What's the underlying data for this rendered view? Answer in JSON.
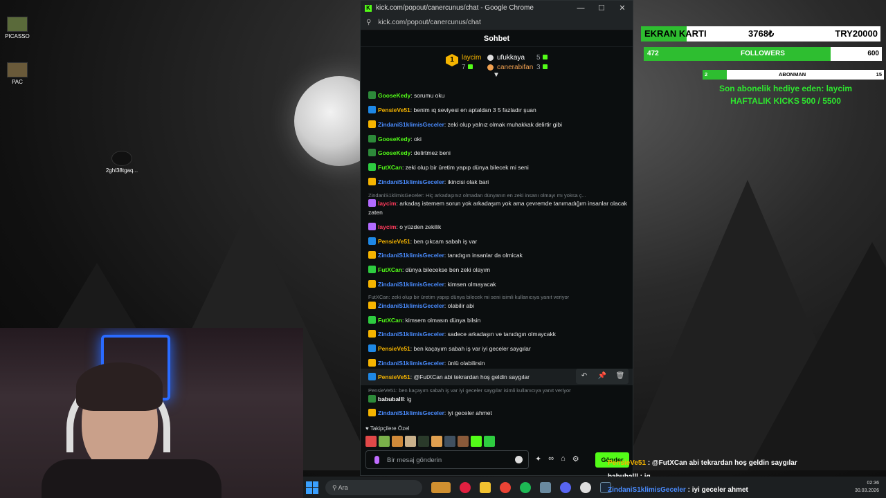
{
  "desktop": {
    "icons": [
      {
        "label": "PICASSO"
      },
      {
        "label": "PAC"
      },
      {
        "label": "2ghl38tgaq..."
      }
    ]
  },
  "browser": {
    "title": "kick.com/popout/canercunus/chat - Google Chrome",
    "url": "kick.com/popout/canercunus/chat",
    "controls": {
      "minimize": "—",
      "maximize": "☐",
      "close": "✕"
    }
  },
  "chat": {
    "header": "Sohbet",
    "gifters": [
      {
        "rank": "1",
        "name": "laycim",
        "count": "7",
        "color": "#f5b400"
      },
      {
        "name": "ufukkaya",
        "count": "5",
        "color": "#ffffff"
      },
      {
        "name": "canerabifan",
        "count": "3",
        "color": "#f0a050"
      }
    ],
    "messages": [
      {
        "user": "GooseKedy",
        "color": "#53fc18",
        "badge": "#2d8a3a",
        "text": ": sorumu oku"
      },
      {
        "user": "PensieVe51",
        "color": "#f5b400",
        "badge": "#1e88e5",
        "text": ": benim ıq seviyesi en aptaldan 3 5 fazladır şuan"
      },
      {
        "user": "ZindaniS1klimisGeceler",
        "color": "#4a8cff",
        "badge": "#f5b400",
        "text": ": zeki olup yalnız olmak muhakkak delirtir gibi"
      },
      {
        "user": "GooseKedy",
        "color": "#53fc18",
        "badge": "#2d8a3a",
        "text": ": oki"
      },
      {
        "user": "GooseKedy",
        "color": "#53fc18",
        "badge": "#2d8a3a",
        "text": ": delirtmez beni"
      },
      {
        "user": "FutXCan",
        "color": "#53fc18",
        "badge": "#2ecc40",
        "text": ": zeki olup bir üretim yapıp dünya bilecek mi seni"
      },
      {
        "user": "ZindaniS1klimisGeceler",
        "color": "#4a8cff",
        "badge": "#f5b400",
        "text": ": ikincisi olak bari"
      },
      {
        "reply": "ZindaniS1klimisGeceler: Hiç arkadaşınız olmadan dünyanın en zeki insanı olmayı mı yoksa ç..."
      },
      {
        "user": "laycim",
        "color": "#ff3b5c",
        "badge": "#b36bff",
        "text": ": arkadaş istemem sorun yok arkadaşım yok ama çevremde tanımadığım insanlar olacak zaten"
      },
      {
        "user": "laycim",
        "color": "#ff3b5c",
        "badge": "#b36bff",
        "text": ": o yüzden zekilik"
      },
      {
        "user": "PensieVe51",
        "color": "#f5b400",
        "badge": "#1e88e5",
        "text": ": ben çıkcam sabah iş var"
      },
      {
        "user": "ZindaniS1klimisGeceler",
        "color": "#4a8cff",
        "badge": "#f5b400",
        "text": ": tanıdıgın insanlar da olmicak"
      },
      {
        "user": "FutXCan",
        "color": "#53fc18",
        "badge": "#2ecc40",
        "text": ": dünya bilecekse ben zeki olayım"
      },
      {
        "user": "ZindaniS1klimisGeceler",
        "color": "#4a8cff",
        "badge": "#f5b400",
        "text": ": kimsen olmayacak"
      },
      {
        "reply": "FutXCan: zeki olup bir üretim yapıp dünya bilecek mi seni isimli kullanıcıya yanıt veriyor"
      },
      {
        "user": "ZindaniS1klimisGeceler",
        "color": "#4a8cff",
        "badge": "#f5b400",
        "text": ": olabilir abi"
      },
      {
        "user": "FutXCan",
        "color": "#53fc18",
        "badge": "#2ecc40",
        "text": ": kimsem olmasın dünya bilsin"
      },
      {
        "user": "ZindaniS1klimisGeceler",
        "color": "#4a8cff",
        "badge": "#f5b400",
        "text": ": sadece arkadaşın ve tanıdıgın olmaycakk"
      },
      {
        "user": "PensieVe51",
        "color": "#f5b400",
        "badge": "#1e88e5",
        "text": ": ben kaçayım sabah iş var iyi geceler saygılar"
      },
      {
        "user": "ZindaniS1klimisGeceler",
        "color": "#4a8cff",
        "badge": "#f5b400",
        "text": ": ünlü olabilirsin"
      },
      {
        "user": "PensieVe51",
        "color": "#f5b400",
        "badge": "#1e88e5",
        "text": ": @FutXCan abi tekrardan hoş geldin saygılar"
      },
      {
        "reply": "PensieVe51: ben kaçayım sabah iş var iyi geceler saygılar isimli kullanıcıya yanıt veriyor"
      },
      {
        "user": "babuballl",
        "color": "#ffffff",
        "badge": "#2d8a3a",
        "text": ": ig"
      },
      {
        "user": "ZindaniS1klimisGeceler",
        "color": "#4a8cff",
        "badge": "#f5b400",
        "text": ": iyi geceler ahmet"
      }
    ],
    "hover_actions": [
      "↶",
      "📌",
      "🗑"
    ],
    "followers_only_label": "♥ Takipçilere Özel",
    "emote_colors": [
      "#e04848",
      "#7ab04a",
      "#d08a3a",
      "#c9b08a",
      "#2a3a2a",
      "#e0a050",
      "#405060",
      "#8a5a3a",
      "#53fc18",
      "#2ecc40"
    ],
    "input_placeholder": "Bir mesaj gönderin",
    "send_label": "Gönder",
    "tool_icons": [
      "✦",
      "∞",
      "⌂",
      "⚙"
    ]
  },
  "overlay": {
    "ekran_karti": {
      "label": "EKRAN KARTI",
      "value": "3768₺",
      "goal": "TRY20000",
      "progress": 0.19
    },
    "followers": {
      "current": "472",
      "label": "FOLLOWERS",
      "goal": "600",
      "progress": 0.786
    },
    "abonman": {
      "current": "2",
      "label": "ABONMAN",
      "goal": "15",
      "progress": 0.133
    },
    "last_gift": "Son abonelik hediye eden: laycim",
    "weekly_kicks": "HAFTALIK KICKS 500 / 5500",
    "accent": "#2ee62f"
  },
  "stream_chat": [
    {
      "user": "PensieVe51",
      "text": " : @FutXCan abi tekrardan hoş geldin saygılar",
      "color": "#f5b400"
    },
    {
      "user": "babuballl",
      "text": " : ig",
      "color": "#ffffff"
    },
    {
      "user": "ZindaniS1klimisGeceler",
      "text": " : iyi geceler ahmet",
      "color": "#4a8cff"
    }
  ],
  "taskbar": {
    "search_placeholder": "Ara",
    "time": "02:36",
    "date": "30.03.2026"
  }
}
